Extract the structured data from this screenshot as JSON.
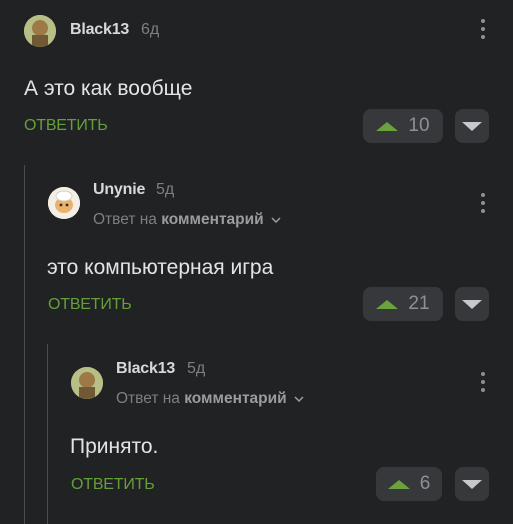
{
  "comments": [
    {
      "username": "Black13",
      "age": "6д",
      "text": "А это как вообще",
      "reply_label": "ОТВЕТИТЬ",
      "rating": "10"
    },
    {
      "username": "Unynie",
      "age": "5д",
      "reply_prefix": "Ответ на",
      "reply_target": "комментарий",
      "text": "это компьютерная игра",
      "reply_label": "ОТВЕТИТЬ",
      "rating": "21"
    },
    {
      "username": "Black13",
      "age": "5д",
      "reply_prefix": "Ответ на",
      "reply_target": "комментарий",
      "text": "Принято.",
      "reply_label": "ОТВЕТИТЬ",
      "rating": "6"
    }
  ],
  "icons": {
    "upvote": "triangle-up-icon",
    "downvote": "triangle-down-icon",
    "more": "kebab-menu-icon",
    "expand": "chevron-down-icon"
  },
  "colors": {
    "background": "#212224",
    "accent_green": "#64a03a",
    "text": "#e3e4e6",
    "muted": "#7d7f83"
  }
}
